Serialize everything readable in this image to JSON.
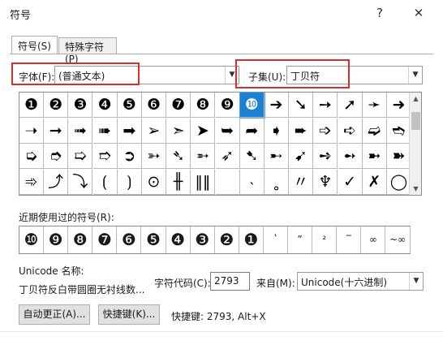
{
  "window": {
    "title": "符号",
    "help_label": "?",
    "close_label": "✕"
  },
  "tabs": [
    {
      "label": "符号(S)",
      "active": true
    },
    {
      "label": "特殊字符(P)",
      "active": false
    }
  ],
  "font": {
    "label": "字体(F):",
    "value": "(普通文本)"
  },
  "subset": {
    "label": "子集(U):",
    "value": "丁贝符"
  },
  "symbol_rows": [
    [
      "❶",
      "❷",
      "❸",
      "❹",
      "❺",
      "❻",
      "❼",
      "❽",
      "❾",
      "❿",
      "➔",
      "➘",
      "➙",
      "➚",
      "➛",
      "➜"
    ],
    [
      "➝",
      "➞",
      "➟",
      "➠",
      "➡",
      "➢",
      "➣",
      "➤",
      "➥",
      "➦",
      "➧",
      "➨",
      "➩",
      "➪",
      "➫",
      "➬"
    ],
    [
      "➭",
      "➮",
      "➯",
      "➱",
      "➲",
      "➳",
      "➴",
      "➵",
      "➶",
      "➷",
      "➸",
      "➹",
      "➺",
      "➻",
      "➼",
      "➽"
    ],
    [
      "➾",
      "⤴",
      "⤵",
      "⟮",
      "⟯",
      "⊙",
      "╫",
      "‖‖",
      "",
      "˴",
      "˳",
      "〃",
      "♆",
      "✓",
      "✗",
      "◯"
    ]
  ],
  "selected_symbol": "❿",
  "recent": {
    "label": "近期使用过的符号(R):",
    "symbols": [
      "❿",
      "❾",
      "❽",
      "❼",
      "❻",
      "❺",
      "❹",
      "❸",
      "❷",
      "❶",
      "ʽ",
      "ˮ",
      "²",
      "‾",
      "∞",
      "~∞"
    ]
  },
  "unicode_name": {
    "label": "Unicode 名称:",
    "value": "丁贝符反白带圆圈无衬线数..."
  },
  "char_code": {
    "label": "字符代码(C):",
    "value": "2793"
  },
  "from": {
    "label": "来自(M):",
    "value": "Unicode(十六进制)"
  },
  "buttons": {
    "autocorrect": "自动更正(A)...",
    "shortcut": "快捷键(K)..."
  },
  "shortcut_info": "快捷键: 2793, Alt+X",
  "colors": {
    "selection": "#1e7fd6",
    "highlight_box": "#d62e2e"
  }
}
